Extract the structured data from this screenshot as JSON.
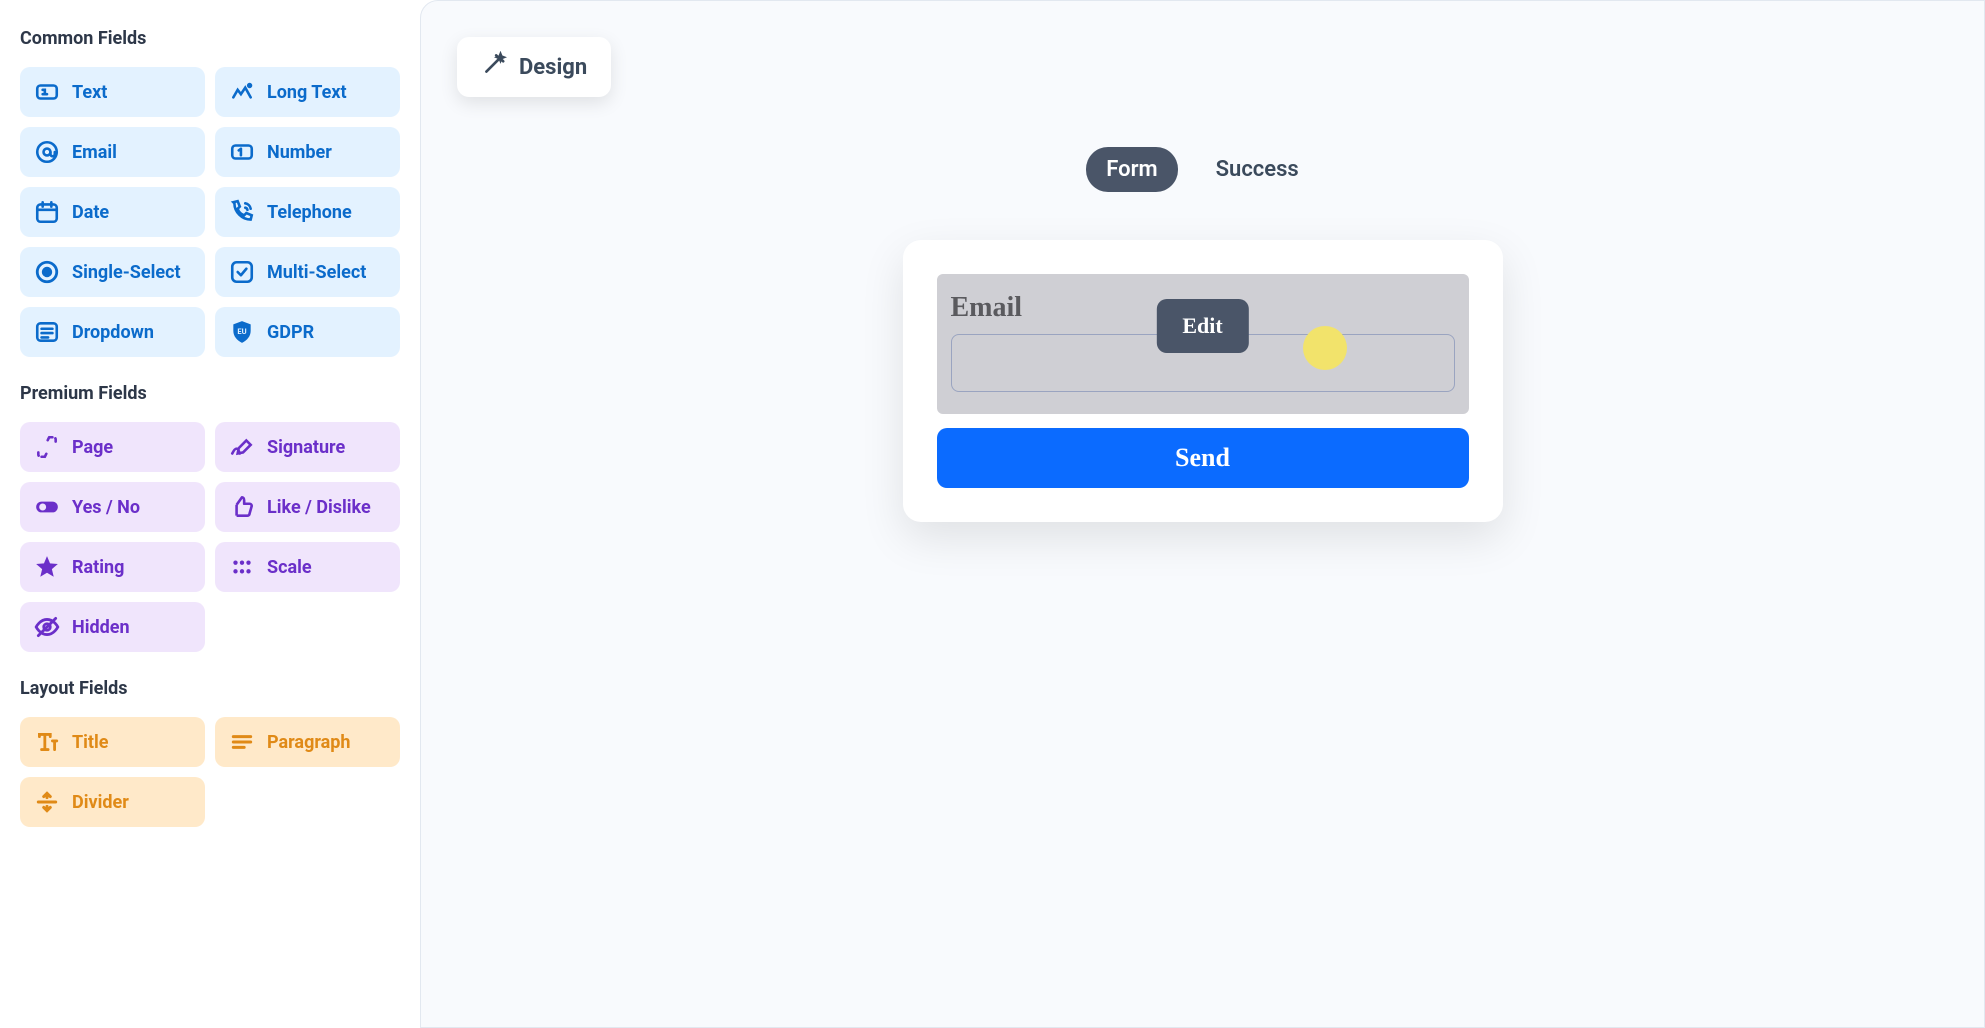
{
  "sidebar": {
    "sections": {
      "common": {
        "title": "Common Fields",
        "items": [
          {
            "label": "Text",
            "icon": "text-icon"
          },
          {
            "label": "Long Text",
            "icon": "long-text-icon"
          },
          {
            "label": "Email",
            "icon": "email-icon"
          },
          {
            "label": "Number",
            "icon": "number-icon"
          },
          {
            "label": "Date",
            "icon": "date-icon"
          },
          {
            "label": "Telephone",
            "icon": "telephone-icon"
          },
          {
            "label": "Single-Select",
            "icon": "single-select-icon"
          },
          {
            "label": "Multi-Select",
            "icon": "multi-select-icon"
          },
          {
            "label": "Dropdown",
            "icon": "dropdown-icon"
          },
          {
            "label": "GDPR",
            "icon": "gdpr-icon"
          }
        ]
      },
      "premium": {
        "title": "Premium Fields",
        "items": [
          {
            "label": "Page",
            "icon": "page-icon"
          },
          {
            "label": "Signature",
            "icon": "signature-icon"
          },
          {
            "label": "Yes / No",
            "icon": "toggle-icon"
          },
          {
            "label": "Like / Dislike",
            "icon": "thumbs-up-icon"
          },
          {
            "label": "Rating",
            "icon": "star-icon"
          },
          {
            "label": "Scale",
            "icon": "scale-icon"
          },
          {
            "label": "Hidden",
            "icon": "eye-off-icon"
          }
        ]
      },
      "layout": {
        "title": "Layout Fields",
        "items": [
          {
            "label": "Title",
            "icon": "title-icon"
          },
          {
            "label": "Paragraph",
            "icon": "paragraph-icon"
          },
          {
            "label": "Divider",
            "icon": "divider-icon"
          }
        ]
      }
    }
  },
  "toolbar": {
    "design_label": "Design"
  },
  "tabs": {
    "form": "Form",
    "success": "Success"
  },
  "form": {
    "email_label": "Email",
    "submit_label": "Send",
    "edit_tooltip": "Edit"
  },
  "colors": {
    "common_bg": "#e3f2ff",
    "common_fg": "#0b6bcb",
    "premium_bg": "#f0e5fc",
    "premium_fg": "#6b2fc9",
    "layout_bg": "#ffe9c9",
    "layout_fg": "#e08a17",
    "accent_blue": "#0b6bff",
    "dark_gray": "#4a5568"
  }
}
